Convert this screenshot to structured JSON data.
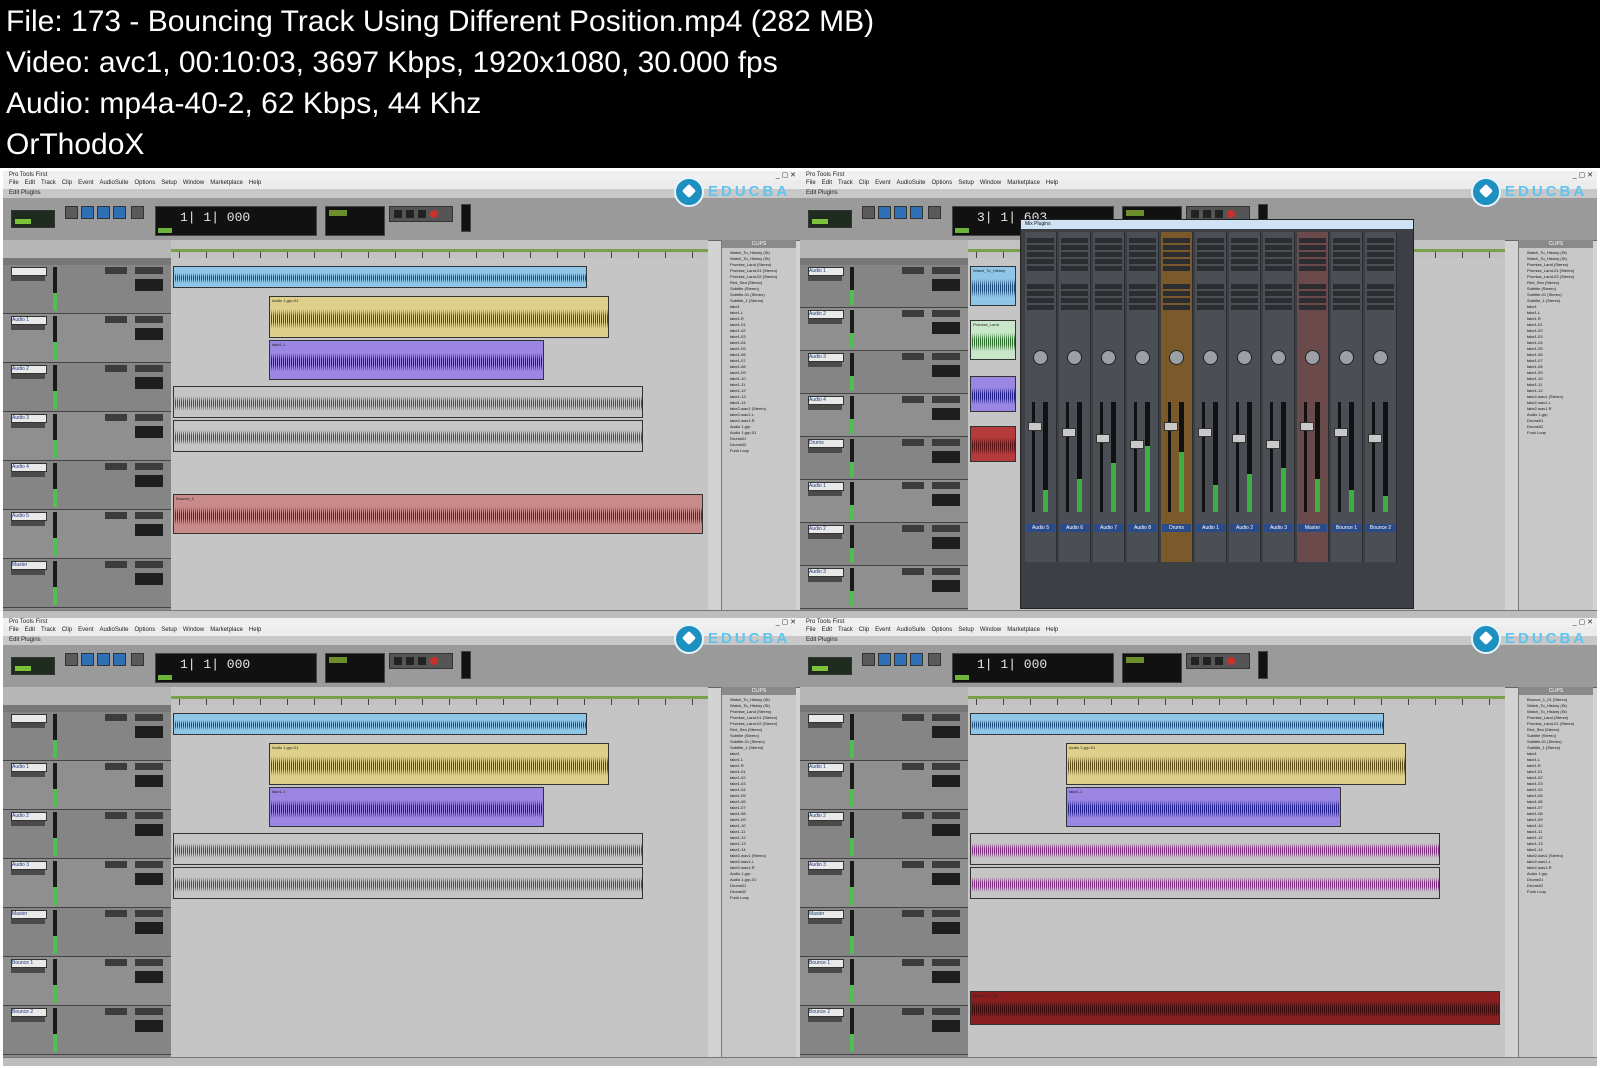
{
  "info": {
    "file": "File: 173 - Bouncing Track Using Different Position.mp4 (282 MB)",
    "video": "Video: avc1, 00:10:03, 3697 Kbps, 1920x1080, 30.000 fps",
    "audio": "Audio: mp4a-40-2, 62 Kbps, 44 Khz",
    "uploader": "OrThodoX"
  },
  "app": {
    "window_title": "Pro Tools First",
    "window_controls": "_ ▢ ✕",
    "menu": [
      "File",
      "Edit",
      "Track",
      "Clip",
      "Event",
      "AudioSuite",
      "Options",
      "Setup",
      "Window",
      "Marketplace",
      "Help"
    ],
    "subbar": "Edit Plugins",
    "logo_text": "EDUCBA",
    "clips_header": "CLIPS",
    "mixer_title": "Mix Plugins"
  },
  "colors": {
    "midi_clip": "#8fc6e8",
    "audio1": "#ded08a",
    "audio2": "#9b86e4",
    "audio3": "#b988c4",
    "bounce": "#c98a8a",
    "bounce_dark": "#8a1e1e",
    "wave_gold": "#5a4a14",
    "wave_blue": "#1c1a86",
    "wave_purple": "#7a2a7a",
    "wave_red": "#6a1f1f"
  },
  "panels": [
    {
      "counter": "1| 1| 000",
      "tracks": [
        "",
        "Audio 1",
        "Audio 2",
        "Audio 3",
        "Audio 4",
        "Audio 5",
        "Master"
      ],
      "clip_labels": [
        "Audio 1.grp-01",
        "take1-1",
        "Bounce_1"
      ],
      "clips": [
        "Watch_To_History (St)",
        "Watch_To_History (St)",
        "Promise_Land (Stereo)",
        "Promise_Land-01 (Stereo)",
        "Promise_Land-02 (Stereo)",
        "Red_Sea (Stereo)",
        "Subtitle (Stereo)",
        "Subtitle-01 (Stereo)",
        "Subtitle_1 (Stereo)",
        "take1",
        "take1.L",
        "take1.R",
        "take1-01",
        "take1-02",
        "take1-03",
        "take1-04",
        "take1-05",
        "take1-06",
        "take1-07",
        "take1-08",
        "take1-09",
        "take1-10",
        "take1-11",
        "take1-12",
        "take1-13",
        "take1-14",
        "take2-wav1 (Stereo)",
        "take2-wav1.L",
        "take2-wav1.R",
        "Audio 1.grp",
        "Audio 1.grp-01",
        "Drums01",
        "Drums02",
        "Funk Loop"
      ]
    },
    {
      "counter": "3| 1| 603",
      "tracks": [
        "Audio 1",
        "Audio 2",
        "Audio 3",
        "Audio 4",
        "Drums",
        "Audio 1",
        "Audio 2",
        "Audio 3"
      ],
      "clip_labels": [
        "Watch_To_History",
        "Promise_Land"
      ],
      "mixer_strips": [
        "Audio 5",
        "Audio 6",
        "Audio 7",
        "Audio 8",
        "Drums",
        "Audio 1",
        "Audio 2",
        "Audio 3",
        "Master",
        "Bounce 1",
        "Bounce 2"
      ],
      "clips": [
        "Watch_To_History (St)",
        "Watch_To_History (St)",
        "Promise_Land (Stereo)",
        "Promise_Land-01 (Stereo)",
        "Promise_Land-02 (Stereo)",
        "Red_Sea (Stereo)",
        "Subtitle (Stereo)",
        "Subtitle-01 (Stereo)",
        "Subtitle_1 (Stereo)",
        "take1",
        "take1.L",
        "take1.R",
        "take1-01",
        "take1-02",
        "take1-03",
        "take1-04",
        "take1-05",
        "take1-06",
        "take1-07",
        "take1-08",
        "take1-09",
        "take1-10",
        "take1-11",
        "take1-12",
        "take2-wav1 (Stereo)",
        "take2-wav1.L",
        "take2-wav1.R",
        "Audio 1.grp",
        "Drums01",
        "Drums02",
        "Funk Loop"
      ]
    },
    {
      "counter": "1| 1| 000",
      "tracks": [
        "",
        "Audio 1",
        "Audio 2",
        "Audio 3",
        "Master",
        "Bounce 1",
        "Bounce 2"
      ],
      "clip_labels": [
        "Audio 1.grp-01",
        "take1-1"
      ],
      "clips": [
        "Watch_To_History (St)",
        "Watch_To_History (St)",
        "Promise_Land (Stereo)",
        "Promise_Land-01 (Stereo)",
        "Promise_Land-02 (Stereo)",
        "Red_Sea (Stereo)",
        "Subtitle (Stereo)",
        "Subtitle-01 (Stereo)",
        "Subtitle_1 (Stereo)",
        "take1",
        "take1.L",
        "take1.R",
        "take1-01",
        "take1-02",
        "take1-03",
        "take1-04",
        "take1-05",
        "take1-06",
        "take1-07",
        "take1-08",
        "take1-09",
        "take1-10",
        "take1-11",
        "take1-12",
        "take1-13",
        "take1-14",
        "take2-wav1 (Stereo)",
        "take2-wav1.L",
        "take2-wav1.R",
        "Audio 1.grp",
        "Audio 1.grp-01",
        "Drums01",
        "Drums02",
        "Funk Loop"
      ]
    },
    {
      "counter": "1| 1| 000",
      "tracks": [
        "",
        "Audio 1",
        "Audio 2",
        "Audio 3",
        "Master",
        "Bounce 1",
        "Bounce 2"
      ],
      "clip_labels": [
        "Audio 1.grp-01",
        "take1-1",
        "Bounce_1_01"
      ],
      "clips": [
        "Bounce_1_01 (Stereo)",
        "Watch_To_History (St)",
        "Watch_To_History (St)",
        "Promise_Land (Stereo)",
        "Promise_Land-01 (Stereo)",
        "Red_Sea (Stereo)",
        "Subtitle (Stereo)",
        "Subtitle-01 (Stereo)",
        "Subtitle_1 (Stereo)",
        "take1",
        "take1.L",
        "take1.R",
        "take1-01",
        "take1-02",
        "take1-03",
        "take1-04",
        "take1-05",
        "take1-06",
        "take1-07",
        "take1-08",
        "take1-09",
        "take1-10",
        "take1-11",
        "take1-12",
        "take1-13",
        "take1-14",
        "take2-wav1 (Stereo)",
        "take2-wav1.L",
        "take2-wav1.R",
        "Audio 1.grp",
        "Drums01",
        "Drums02",
        "Funk Loop"
      ]
    }
  ]
}
